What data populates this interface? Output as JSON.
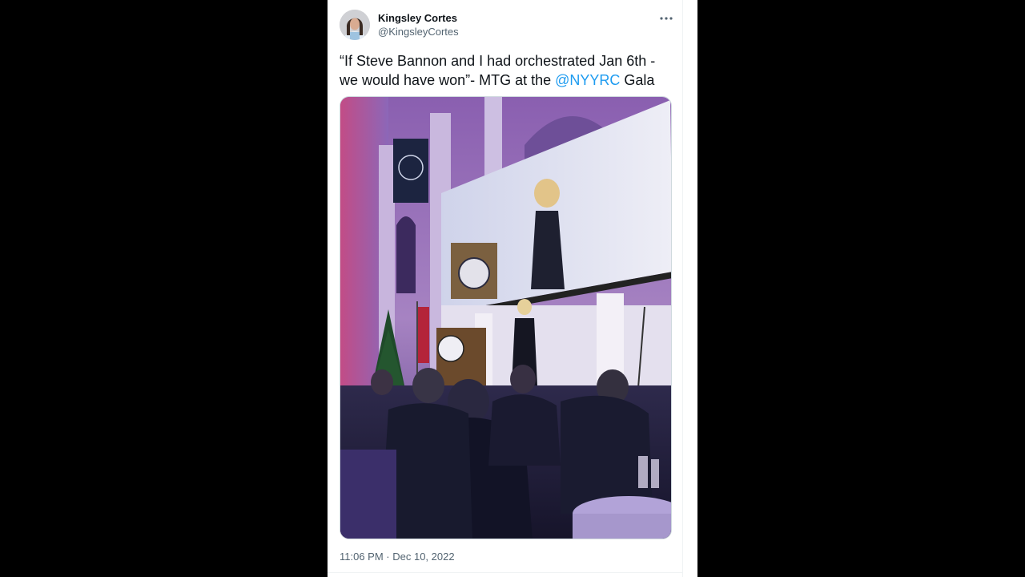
{
  "tweet": {
    "author": {
      "display_name": "Kingsley Cortes",
      "handle": "@KingsleyCortes"
    },
    "text_part1": "“If Steve Bannon and I had orchestrated Jan 6th - we would have won”- MTG at the ",
    "mention": "@NYYRC",
    "text_part2": " Gala",
    "timestamp": "11:06 PM · Dec 10, 2022",
    "more_icon": "more-horizontal-icon",
    "photo_alt": "photo"
  },
  "colors": {
    "link": "#1d9bf0",
    "text_primary": "#0f1419",
    "text_secondary": "#536471",
    "background": "#000000",
    "card": "#ffffff"
  }
}
